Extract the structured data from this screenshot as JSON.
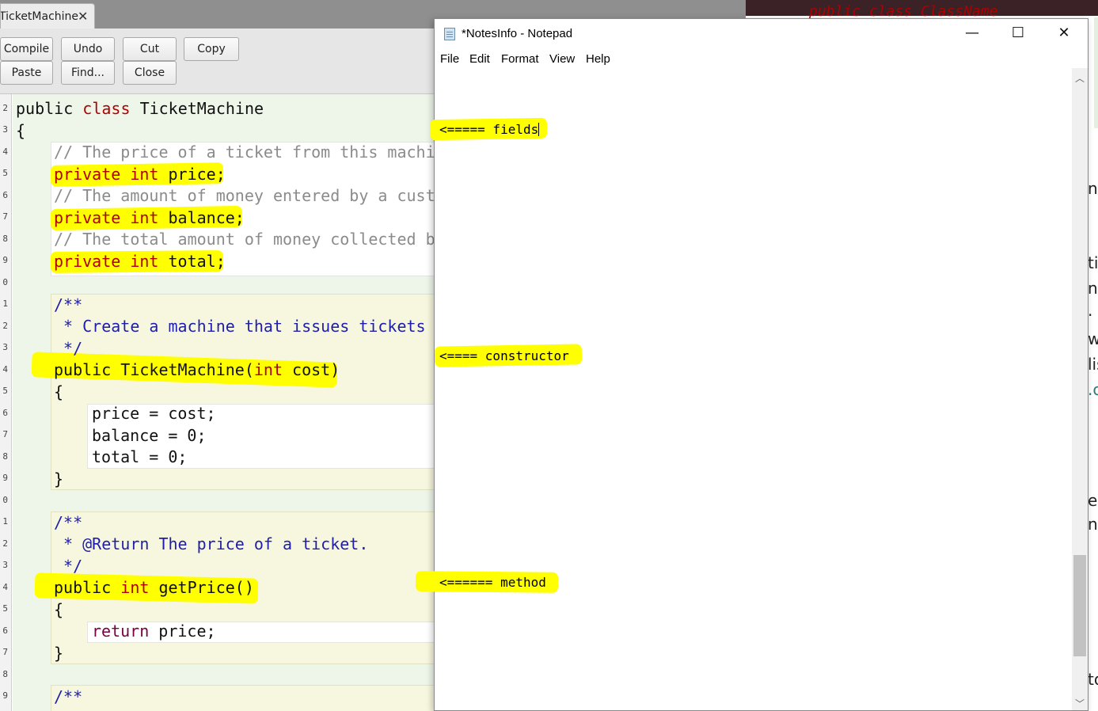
{
  "bluej": {
    "tab_label": "TicketMachine",
    "tab_close": "✕",
    "toolbar": {
      "compile": "Compile",
      "undo": "Undo",
      "cut": "Cut",
      "copy": "Copy",
      "paste": "Paste",
      "find": "Find...",
      "close": "Close"
    },
    "line_numbers": [
      "2",
      "3",
      "4",
      "5",
      "6",
      "7",
      "8",
      "9",
      "0",
      "1",
      "2",
      "3",
      "4",
      "5",
      "6",
      "7",
      "8",
      "9",
      "0",
      "1",
      "2",
      "3",
      "4",
      "5",
      "6",
      "7",
      "8",
      "9"
    ],
    "code": {
      "l2_pub": "public",
      "l2_cls": "class",
      "l2_name": "TicketMachine",
      "l3": "{",
      "l4": "// The price of a ticket from this machi",
      "l5_priv": "private",
      "l5_int": "int",
      "l5_rest": "price;",
      "l6": "// The amount of money entered by a cust",
      "l7_priv": "private",
      "l7_int": "int",
      "l7_rest": "balance;",
      "l8": "// The total amount of money collected b",
      "l9_priv": "private",
      "l9_int": "int",
      "l9_rest": "total;",
      "l11": "/**",
      "l12": " * Create a machine that issues tickets",
      "l13": " */",
      "l14_pub": "public",
      "l14_mid": "TicketMachine(",
      "l14_int": "int",
      "l14_rest": "cost)",
      "l15": "{",
      "l16": "price = cost;",
      "l17": "balance = 0;",
      "l18": "total = 0;",
      "l19": "}",
      "l21": "/**",
      "l22": " * @Return The price of a ticket.",
      "l23": " */",
      "l24_pub": "public",
      "l24_int": "int",
      "l24_rest": "getPrice()",
      "l25": "{",
      "l26_ret": "return",
      "l26_rest": "price;",
      "l27": "}",
      "l29": "/**"
    }
  },
  "background_window": {
    "code": "public class ClassName",
    "clipped_glyphs": [
      "no",
      "tic",
      "nl",
      ".",
      "w",
      "lis",
      ".c",
      "e",
      "ne",
      "to"
    ]
  },
  "notepad": {
    "title": "*NotesInfo - Notepad",
    "menu": [
      "File",
      "Edit",
      "Format",
      "View",
      "Help"
    ],
    "minimize": "—",
    "maximize": "☐",
    "close": "✕",
    "lines": {
      "fields": "<===== fields",
      "constructor": "<==== constructor",
      "method": "<====== method"
    }
  },
  "colors": {
    "highlight": "#ffff00",
    "keyword": "#b00000",
    "comment": "#8b8b8b",
    "javadoc": "#1e1eaa",
    "class_scope": "#eef6ea",
    "method_scope": "#f7f7df"
  }
}
